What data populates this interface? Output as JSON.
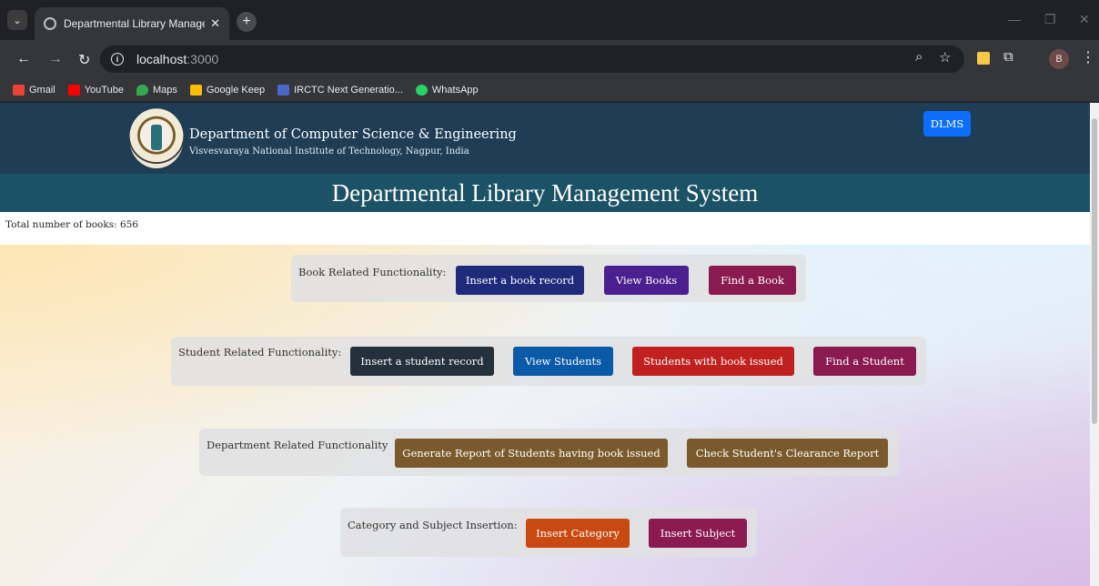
{
  "browser": {
    "tab_title": "Departmental Library Managemen",
    "tab_close": "✕",
    "new_tab": "+",
    "url_host": "localhost",
    "url_port": ":3000",
    "profile_initial": "B",
    "bookmarks": [
      {
        "label": "Gmail",
        "color": "#ea4335"
      },
      {
        "label": "YouTube",
        "color": "#ff0000"
      },
      {
        "label": "Maps",
        "color": "#34a853"
      },
      {
        "label": "Google Keep",
        "color": "#fbbc04"
      },
      {
        "label": "IRCTC Next Generatio...",
        "color": "#4a67c9"
      },
      {
        "label": "WhatsApp",
        "color": "#25d366"
      }
    ]
  },
  "header": {
    "department": "Department of Computer Science & Engineering",
    "institute": "Visvesvaraya National Institute of Technology, Nagpur, India",
    "dlms_button": "DLMS"
  },
  "title": "Departmental Library Management System",
  "book_count": "Total number of books: 656",
  "sections": {
    "book": {
      "label": "Book Related Functionality:",
      "buttons": [
        {
          "label": "Insert a book record",
          "color": "#1f2b7a"
        },
        {
          "label": "View Books",
          "color": "#4b1f8f"
        },
        {
          "label": "Find a Book",
          "color": "#8a1a4f"
        }
      ]
    },
    "student": {
      "label": "Student Related Functionality:",
      "buttons": [
        {
          "label": "Insert a student record",
          "color": "#24303a"
        },
        {
          "label": "View Students",
          "color": "#0b5aa8"
        },
        {
          "label": "Students with book issued",
          "color": "#c0201f"
        },
        {
          "label": "Find a Student",
          "color": "#8a1a4f"
        }
      ]
    },
    "department": {
      "label": "Department Related Functionality",
      "buttons": [
        {
          "label": "Generate Report of Students having book issued",
          "color": "#7a5a2c"
        },
        {
          "label": "Check Student's Clearance Report",
          "color": "#7a5a2c"
        }
      ]
    },
    "category": {
      "label": "Category and Subject Insertion:",
      "buttons": [
        {
          "label": "Insert Category",
          "color": "#c84a12"
        },
        {
          "label": "Insert Subject",
          "color": "#8a1a4f"
        }
      ]
    }
  }
}
